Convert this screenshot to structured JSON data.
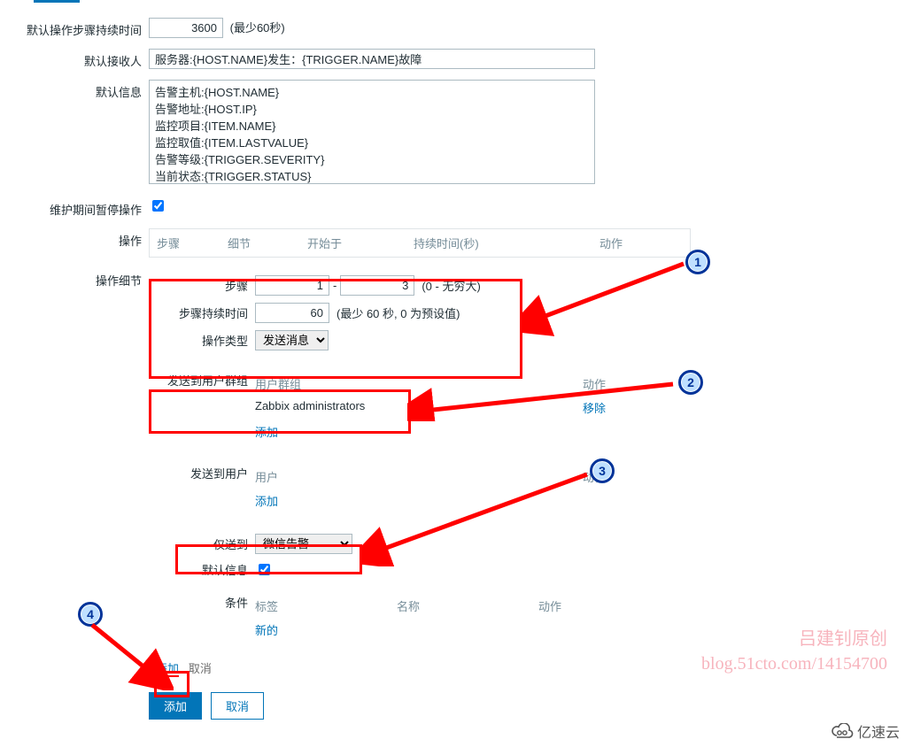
{
  "labels": {
    "default_duration": "默认操作步骤持续时间",
    "default_recipient": "默认接收人",
    "default_message": "默认信息",
    "pause_maintenance": "维护期间暂停操作",
    "operations": "操作",
    "operation_detail": "操作细节",
    "steps_inner": "步骤",
    "step_duration_inner": "步骤持续时间",
    "op_type": "操作类型",
    "send_to_group": "发送到用户群组",
    "send_to_user": "发送到用户",
    "send_only_to": "仅送到",
    "default_msg_inner": "默认信息",
    "conditions": "条件"
  },
  "values": {
    "duration": "3600",
    "duration_hint": "(最少60秒)",
    "recipient": "服务器:{HOST.NAME}发生：{TRIGGER.NAME}故障",
    "message": "告警主机:{HOST.NAME}\n告警地址:{HOST.IP}\n监控项目:{ITEM.NAME}\n监控取值:{ITEM.LASTVALUE}\n告警等级:{TRIGGER.SEVERITY}\n当前状态:{TRIGGER.STATUS}",
    "step_from": "1",
    "step_to": "3",
    "step_hint": "(0 - 无穷大)",
    "step_dur": "60",
    "step_dur_hint": "(最少 60 秒, 0 为预设值)",
    "op_type_val": "发送消息",
    "group_name": "Zabbix administrators",
    "only_to_val": "微信告警"
  },
  "columns": {
    "ops": {
      "step": "步骤",
      "detail": "细节",
      "start": "开始于",
      "dur": "持续时间(秒)",
      "act": "动作"
    },
    "grp": {
      "name": "用户群组",
      "act": "动作"
    },
    "usr": {
      "name": "用户",
      "act": "动作"
    },
    "cond": {
      "tag": "标签",
      "name": "名称",
      "act": "动作"
    }
  },
  "links": {
    "add": "添加",
    "remove": "移除",
    "new": "新的",
    "cancel": "取消"
  },
  "buttons": {
    "add": "添加",
    "cancel": "取消"
  },
  "watermark": {
    "line1": "吕建钊原创",
    "line2": "blog.51cto.com/14154700",
    "brand": "亿速云"
  },
  "annotations": [
    "1",
    "2",
    "3",
    "4"
  ]
}
